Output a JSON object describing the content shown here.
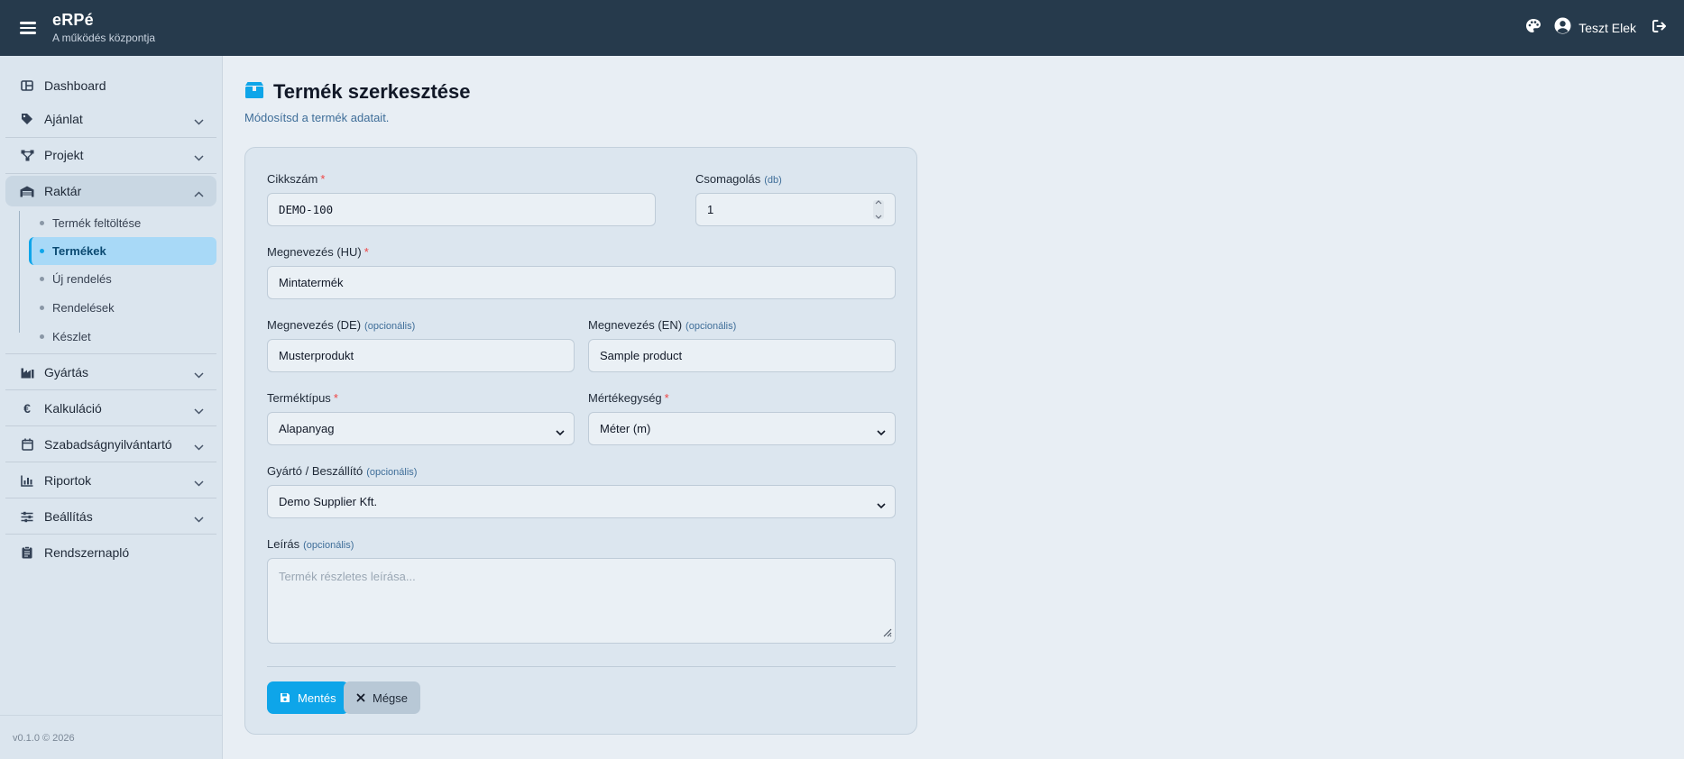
{
  "app": {
    "title": "eRPé",
    "subtitle": "A működés központja"
  },
  "header": {
    "user_name": "Teszt Elek"
  },
  "sidebar": {
    "items": [
      {
        "label": "Dashboard"
      },
      {
        "label": "Ajánlat"
      },
      {
        "label": "Projekt"
      },
      {
        "label": "Raktár"
      },
      {
        "label": "Gyártás"
      },
      {
        "label": "Kalkuláció"
      },
      {
        "label": "Szabadságnyilvántartó"
      },
      {
        "label": "Riportok"
      },
      {
        "label": "Beállítás"
      },
      {
        "label": "Rendszernapló"
      }
    ],
    "raktar_sub": [
      {
        "label": "Termék feltöltése"
      },
      {
        "label": "Termékek"
      },
      {
        "label": "Új rendelés"
      },
      {
        "label": "Rendelések"
      },
      {
        "label": "Készlet"
      }
    ],
    "version": "v0.1.0 © 2026"
  },
  "page": {
    "title": "Termék szerkesztése",
    "subtitle": "Módosítsd a termék adatait."
  },
  "form": {
    "sku": {
      "label": "Cikkszám",
      "value": "DEMO-100"
    },
    "pack": {
      "label": "Csomagolás",
      "unit": "(db)",
      "value": "1"
    },
    "name_hu": {
      "label": "Megnevezés (HU)",
      "value": "Mintatermék"
    },
    "name_de": {
      "label": "Megnevezés (DE)",
      "value": "Musterprodukt"
    },
    "name_en": {
      "label": "Megnevezés (EN)",
      "value": "Sample product"
    },
    "type": {
      "label": "Terméktípus",
      "value": "Alapanyag"
    },
    "uom": {
      "label": "Mértékegység",
      "value": "Méter (m)"
    },
    "supplier": {
      "label": "Gyártó / Beszállító",
      "value": "Demo Supplier Kft."
    },
    "description": {
      "label": "Leírás",
      "placeholder": "Termék részletes leírása..."
    },
    "required_mark": "*",
    "optional_tag": "(opcionális)",
    "save_label": "Mentés",
    "cancel_label": "Mégse"
  },
  "colors": {
    "topbar": "#263a4c",
    "accent": "#0ea5e9",
    "active_bg": "#a8d9f7",
    "required": "#ef4444"
  }
}
